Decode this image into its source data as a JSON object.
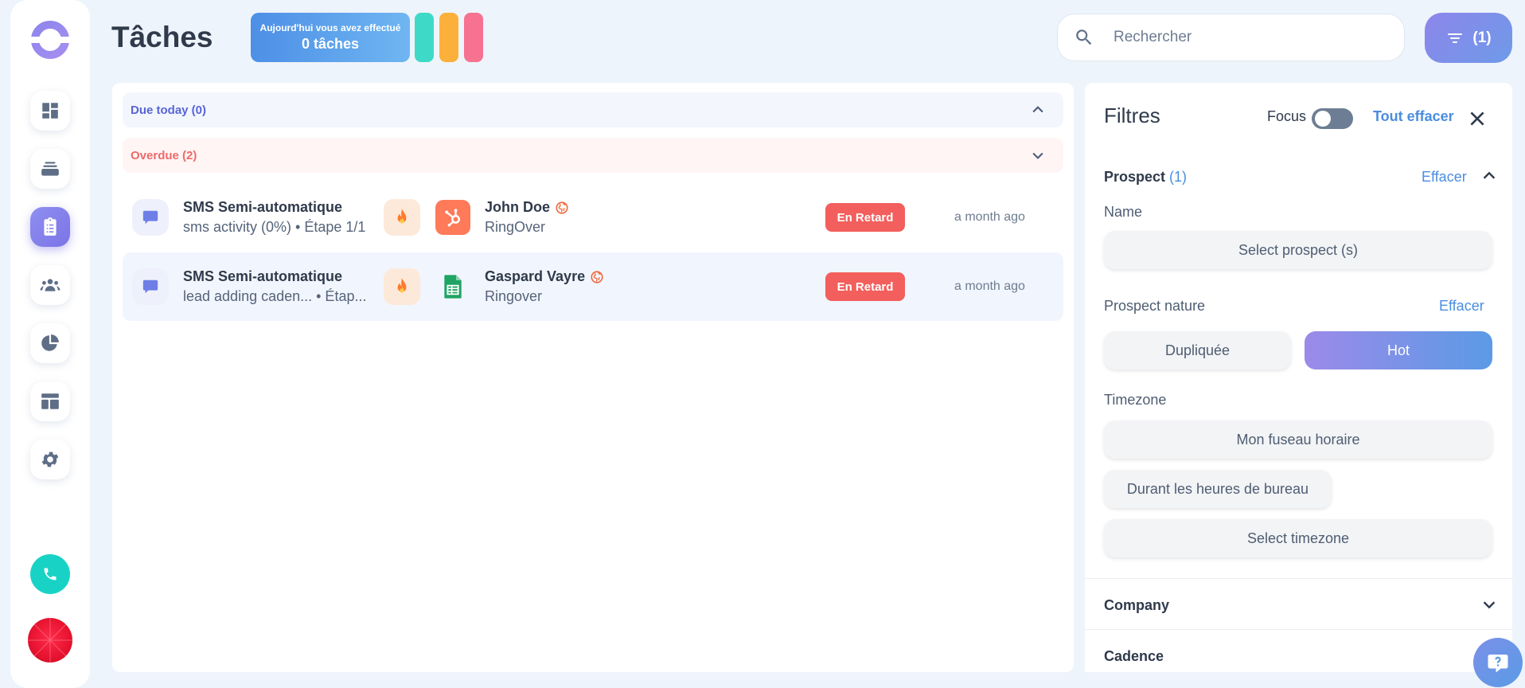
{
  "header": {
    "title": "Tâches",
    "today_line1": "Aujourd'hui vous avez effectué",
    "today_line2": "0 tâches"
  },
  "search": {
    "placeholder": "Rechercher",
    "value": ""
  },
  "filter_button": {
    "label": "(1)"
  },
  "colors": {
    "accent": "#7b74e6",
    "teal": "#18d3c5",
    "late": "#f25f5c",
    "link": "#4a8de0"
  },
  "sidebar": {
    "items": [
      {
        "name": "dashboard",
        "icon": "dashboard-icon"
      },
      {
        "name": "cadences",
        "icon": "layers-icon"
      },
      {
        "name": "tasks",
        "icon": "clipboard-icon",
        "active": true
      },
      {
        "name": "people",
        "icon": "people-icon"
      },
      {
        "name": "stats",
        "icon": "pie-chart-icon"
      },
      {
        "name": "templates",
        "icon": "layout-icon"
      },
      {
        "name": "settings",
        "icon": "gear-icon"
      }
    ]
  },
  "groups": {
    "due_today": "Due today (0)",
    "overdue": "Overdue (2)"
  },
  "tasks": [
    {
      "title": "SMS Semi-automatique",
      "subtitle": "sms activity (0%) • Étape 1/1",
      "source": "hubspot",
      "contact": "John Doe",
      "company": "RingOver",
      "status": "En Retard",
      "time": "a month ago"
    },
    {
      "title": "SMS Semi-automatique",
      "subtitle": "lead adding caden... • Étap...",
      "source": "google-sheets",
      "contact": "Gaspard Vayre",
      "company": "Ringover",
      "status": "En Retard",
      "time": "a month ago"
    }
  ],
  "filters": {
    "title": "Filtres",
    "focus_label": "Focus",
    "clear_all": "Tout effacer",
    "prospect": {
      "label": "Prospect",
      "count": "(1)",
      "clear": "Effacer",
      "name_label": "Name",
      "select_prospect": "Select prospect (s)",
      "nature_label": "Prospect nature",
      "nature_clear": "Effacer",
      "nature_options": [
        "Dupliquée",
        "Hot"
      ],
      "nature_selected": "Hot",
      "timezone_label": "Timezone",
      "tz_mine": "Mon fuseau horaire",
      "tz_office": "Durant les heures de bureau",
      "tz_select": "Select timezone"
    },
    "company_label": "Company",
    "cadence_label": "Cadence"
  }
}
